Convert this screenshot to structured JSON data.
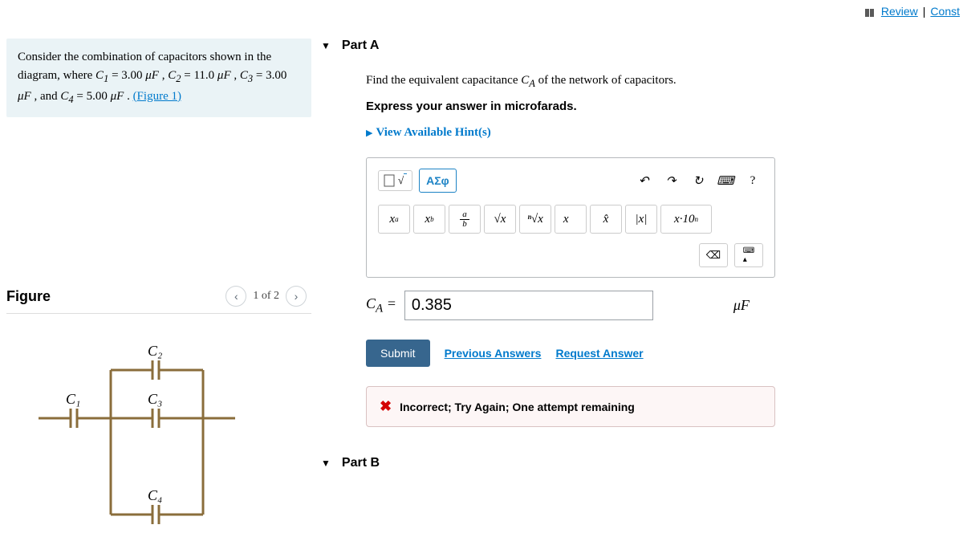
{
  "topbar": {
    "review": "Review",
    "constants": "Const"
  },
  "problem": {
    "pre": "Consider the combination of capacitors shown in the diagram, where ",
    "c1l": "C",
    "c1s": "1",
    "eq": " = ",
    "v1": "3.00 ",
    "mu": "μF",
    "sep": " , ",
    "c2l": "C",
    "c2s": "2",
    "v2": "11.0 ",
    "c3l": "C",
    "c3s": "3",
    "v3": "3.00 ",
    "and": " , and ",
    "c4l": "C",
    "c4s": "4",
    "v4": "5.00 ",
    "dot": " . ",
    "figlink": "(Figure 1)"
  },
  "figure": {
    "title": "Figure",
    "page": "1 of 2",
    "labels": {
      "c1": "C₁",
      "c2": "C₂",
      "c3": "C₃",
      "c4": "C₄"
    }
  },
  "partA": {
    "title": "Part A",
    "q1": "Find the equivalent capacitance ",
    "qC": "C",
    "qA": "A",
    "q2": " of the network of capacitors.",
    "instr": "Express your answer in microfarads.",
    "hints": "View Available Hint(s)"
  },
  "toolbar": {
    "special": "ΑΣφ",
    "sym": {
      "xa": "x",
      "xa_s": "a",
      "xb": "x",
      "xb_s": "b",
      "frac_a": "a",
      "frac_b": "b",
      "sqrt": "√x",
      "nsqrt": "ⁿ√x",
      "vec": "x⃗",
      "hat": "x̂",
      "abs": "|x|",
      "sci": "x·10",
      "sci_n": "n"
    },
    "undo": "↶",
    "redo": "↷",
    "reset": "↻",
    "kb": "⌨",
    "help": "?",
    "bs": "⌫"
  },
  "answer": {
    "label": "C",
    "sub": "A",
    "eq": " = ",
    "value": "0.385",
    "unit": "μF"
  },
  "actions": {
    "submit": "Submit",
    "prev": "Previous Answers",
    "req": "Request Answer"
  },
  "feedback": {
    "text": "Incorrect; Try Again; One attempt remaining"
  },
  "partB": {
    "title": "Part B"
  }
}
